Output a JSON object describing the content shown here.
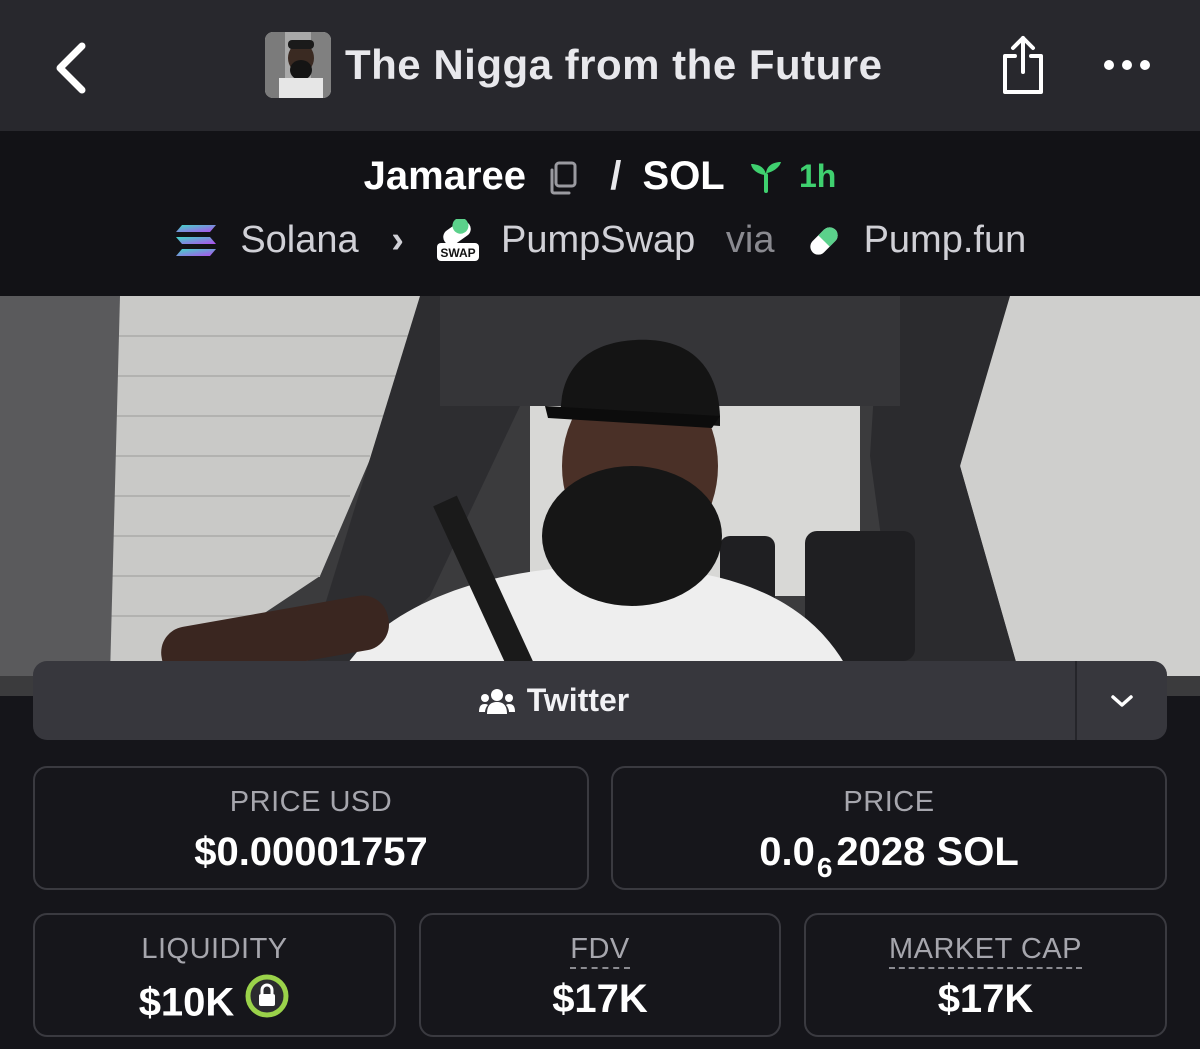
{
  "header": {
    "title": "The Nigga from the Future"
  },
  "pair": {
    "base": "Jamaree",
    "separator": "/",
    "quote": "SOL",
    "age": "1h"
  },
  "chain": {
    "network": "Solana",
    "dex": "PumpSwap",
    "via_label": "via",
    "launchpad": "Pump.fun",
    "dex_badge": "SWAP"
  },
  "links": {
    "twitter_label": "Twitter"
  },
  "stats": {
    "price_usd": {
      "label": "PRICE USD",
      "value": "$0.00001757"
    },
    "price": {
      "label": "PRICE",
      "prefix": "0.0",
      "subscript": "6",
      "rest": "2028 SOL"
    },
    "liquidity": {
      "label": "LIQUIDITY",
      "value": "$10K"
    },
    "fdv": {
      "label": "FDV",
      "value": "$17K"
    },
    "market_cap": {
      "label": "MARKET CAP",
      "value": "$17K"
    }
  },
  "colors": {
    "age_green": "#3fd06f",
    "lock_green": "#9ad24a",
    "header_bg": "#28282d",
    "page_bg": "#15151a"
  }
}
